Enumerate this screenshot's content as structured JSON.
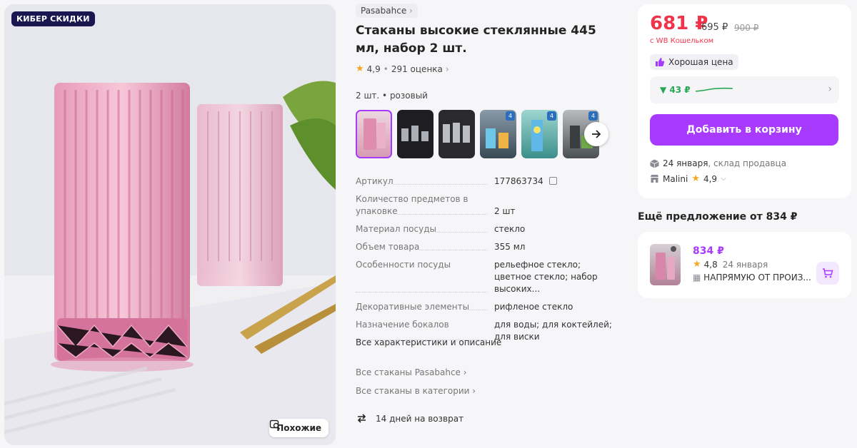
{
  "hero": {
    "badge": "КИБЕР СКИДКИ",
    "similar_label": "Похожие"
  },
  "product": {
    "brand": "Pasabahce",
    "title": "Стаканы высокие стеклянные 445 мл, набор 2 шт.",
    "rating": "4,9",
    "reviews": "291 оценка",
    "variant": "2 шт. • розовый",
    "thumb_badges": [
      "4",
      "4",
      "4"
    ]
  },
  "specs": [
    {
      "key": "Артикул",
      "value": "177863734"
    },
    {
      "key": "Количество предметов в упаковке",
      "value": "2 шт"
    },
    {
      "key": "Материал посуды",
      "value": "стекло"
    },
    {
      "key": "Объем товара",
      "value": "355 мл"
    },
    {
      "key": "Особенности посуды",
      "value": "рельефное стекло; цветное стекло; набор высоких..."
    },
    {
      "key": "Декоративные элементы",
      "value": "рифленое стекло"
    },
    {
      "key": "Назначение бокалов",
      "value": "для воды; для коктейлей; для виски"
    }
  ],
  "links": {
    "all_specs": "Все характеристики и описание",
    "all_brand": "Все стаканы Pasabahce",
    "all_category": "Все стаканы в категории",
    "returns": "14 дней на возврат"
  },
  "buy": {
    "price": "681 ₽",
    "price_old1": "695 ₽",
    "price_old2": "900 ₽",
    "wallet": "с WB Кошельком",
    "good_price": "Хорошая цена",
    "dynamics": "▼ 43 ₽",
    "cart_label": "Добавить в корзину",
    "delivery_date": "24 января",
    "delivery_where": ", склад продавца",
    "seller": "Malini",
    "seller_rating": "4,9"
  },
  "offer": {
    "title": "Ещё предложение от 834 ₽",
    "price": "834 ₽",
    "rating": "4,8",
    "date": "24 января",
    "seller": "НАПРЯМУЮ ОТ ПРОИЗ..."
  },
  "colors": {
    "accent": "#a73afd",
    "price_red": "#f0334a",
    "green": "#2aa756"
  }
}
